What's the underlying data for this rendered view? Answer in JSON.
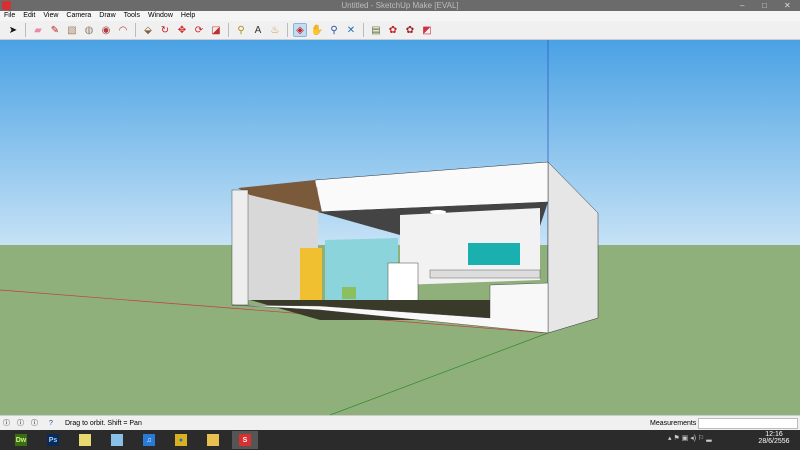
{
  "window": {
    "title": "Untitled - SketchUp Make [EVAL]",
    "minimize": "–",
    "maximize": "□",
    "close": "✕"
  },
  "menu": [
    "File",
    "Edit",
    "View",
    "Camera",
    "Draw",
    "Tools",
    "Window",
    "Help"
  ],
  "toolbar": [
    {
      "name": "select-icon",
      "glyph": "➤",
      "color": "#111"
    },
    {
      "sep": true
    },
    {
      "name": "eraser-icon",
      "glyph": "▰",
      "color": "#e88aa8"
    },
    {
      "name": "pencil-icon",
      "glyph": "✎",
      "color": "#c02020"
    },
    {
      "name": "rectangle-icon",
      "glyph": "▧",
      "color": "#a08060"
    },
    {
      "name": "circle-icon",
      "glyph": "◍",
      "color": "#908070"
    },
    {
      "name": "polygon-icon",
      "glyph": "◉",
      "color": "#b04040"
    },
    {
      "name": "arc-icon",
      "glyph": "◠",
      "color": "#c03030"
    },
    {
      "sep": true
    },
    {
      "name": "push-pull-icon",
      "glyph": "⬙",
      "color": "#806040"
    },
    {
      "name": "follow-me-icon",
      "glyph": "↻",
      "color": "#c02020"
    },
    {
      "name": "move-icon",
      "glyph": "✥",
      "color": "#d02020"
    },
    {
      "name": "rotate-icon",
      "glyph": "⟳",
      "color": "#d02020"
    },
    {
      "name": "scale-icon",
      "glyph": "◪",
      "color": "#c03030"
    },
    {
      "sep": true
    },
    {
      "name": "tape-measure-icon",
      "glyph": "⚲",
      "color": "#b08a10"
    },
    {
      "name": "text-icon",
      "glyph": "A",
      "color": "#333"
    },
    {
      "name": "paint-bucket-icon",
      "glyph": "♨",
      "color": "#c09020"
    },
    {
      "sep": true
    },
    {
      "name": "orbit-icon",
      "glyph": "◈",
      "color": "#c02020",
      "active": true
    },
    {
      "name": "pan-icon",
      "glyph": "✋",
      "color": "#555"
    },
    {
      "name": "zoom-icon",
      "glyph": "⚲",
      "color": "#2050a0"
    },
    {
      "name": "zoom-extents-icon",
      "glyph": "✕",
      "color": "#2070b0"
    },
    {
      "sep": true
    },
    {
      "name": "geo-location-icon",
      "glyph": "▤",
      "color": "#607030"
    },
    {
      "name": "warehouse-icon",
      "glyph": "✿",
      "color": "#c02020"
    },
    {
      "name": "share-model-icon",
      "glyph": "✿",
      "color": "#a02020"
    },
    {
      "name": "extension-warehouse-icon",
      "glyph": "◩",
      "color": "#d03040"
    }
  ],
  "status": {
    "hint": "Drag to orbit.  Shift = Pan",
    "measurements_label": "Measurements",
    "measurements_value": ""
  },
  "taskbar": {
    "apps": [
      {
        "name": "dreamweaver",
        "label": "Dw",
        "bg": "#3a6e12",
        "fg": "#cff28a"
      },
      {
        "name": "photoshop",
        "label": "Ps",
        "bg": "#0a2a5a",
        "fg": "#9fd4ff"
      },
      {
        "name": "notes",
        "label": "",
        "bg": "#e8d870",
        "fg": "#000"
      },
      {
        "name": "tablet-app",
        "label": "",
        "bg": "#8ac0e8",
        "fg": "#000"
      },
      {
        "name": "itunes",
        "label": "♫",
        "bg": "#2a7ad8",
        "fg": "#fff"
      },
      {
        "name": "chrome",
        "label": "●",
        "bg": "#d8b020",
        "fg": "#2a6ad8"
      },
      {
        "name": "file-explorer",
        "label": "",
        "bg": "#e8c050",
        "fg": "#000"
      },
      {
        "name": "sketchup",
        "label": "S",
        "bg": "#d83030",
        "fg": "#fff"
      }
    ],
    "time": "12:16",
    "date": "28/6/2556"
  },
  "colors": {
    "sky_top": "#4aa2e4",
    "sky_bottom": "#c6e2f6",
    "ground": "#8fb07a"
  }
}
